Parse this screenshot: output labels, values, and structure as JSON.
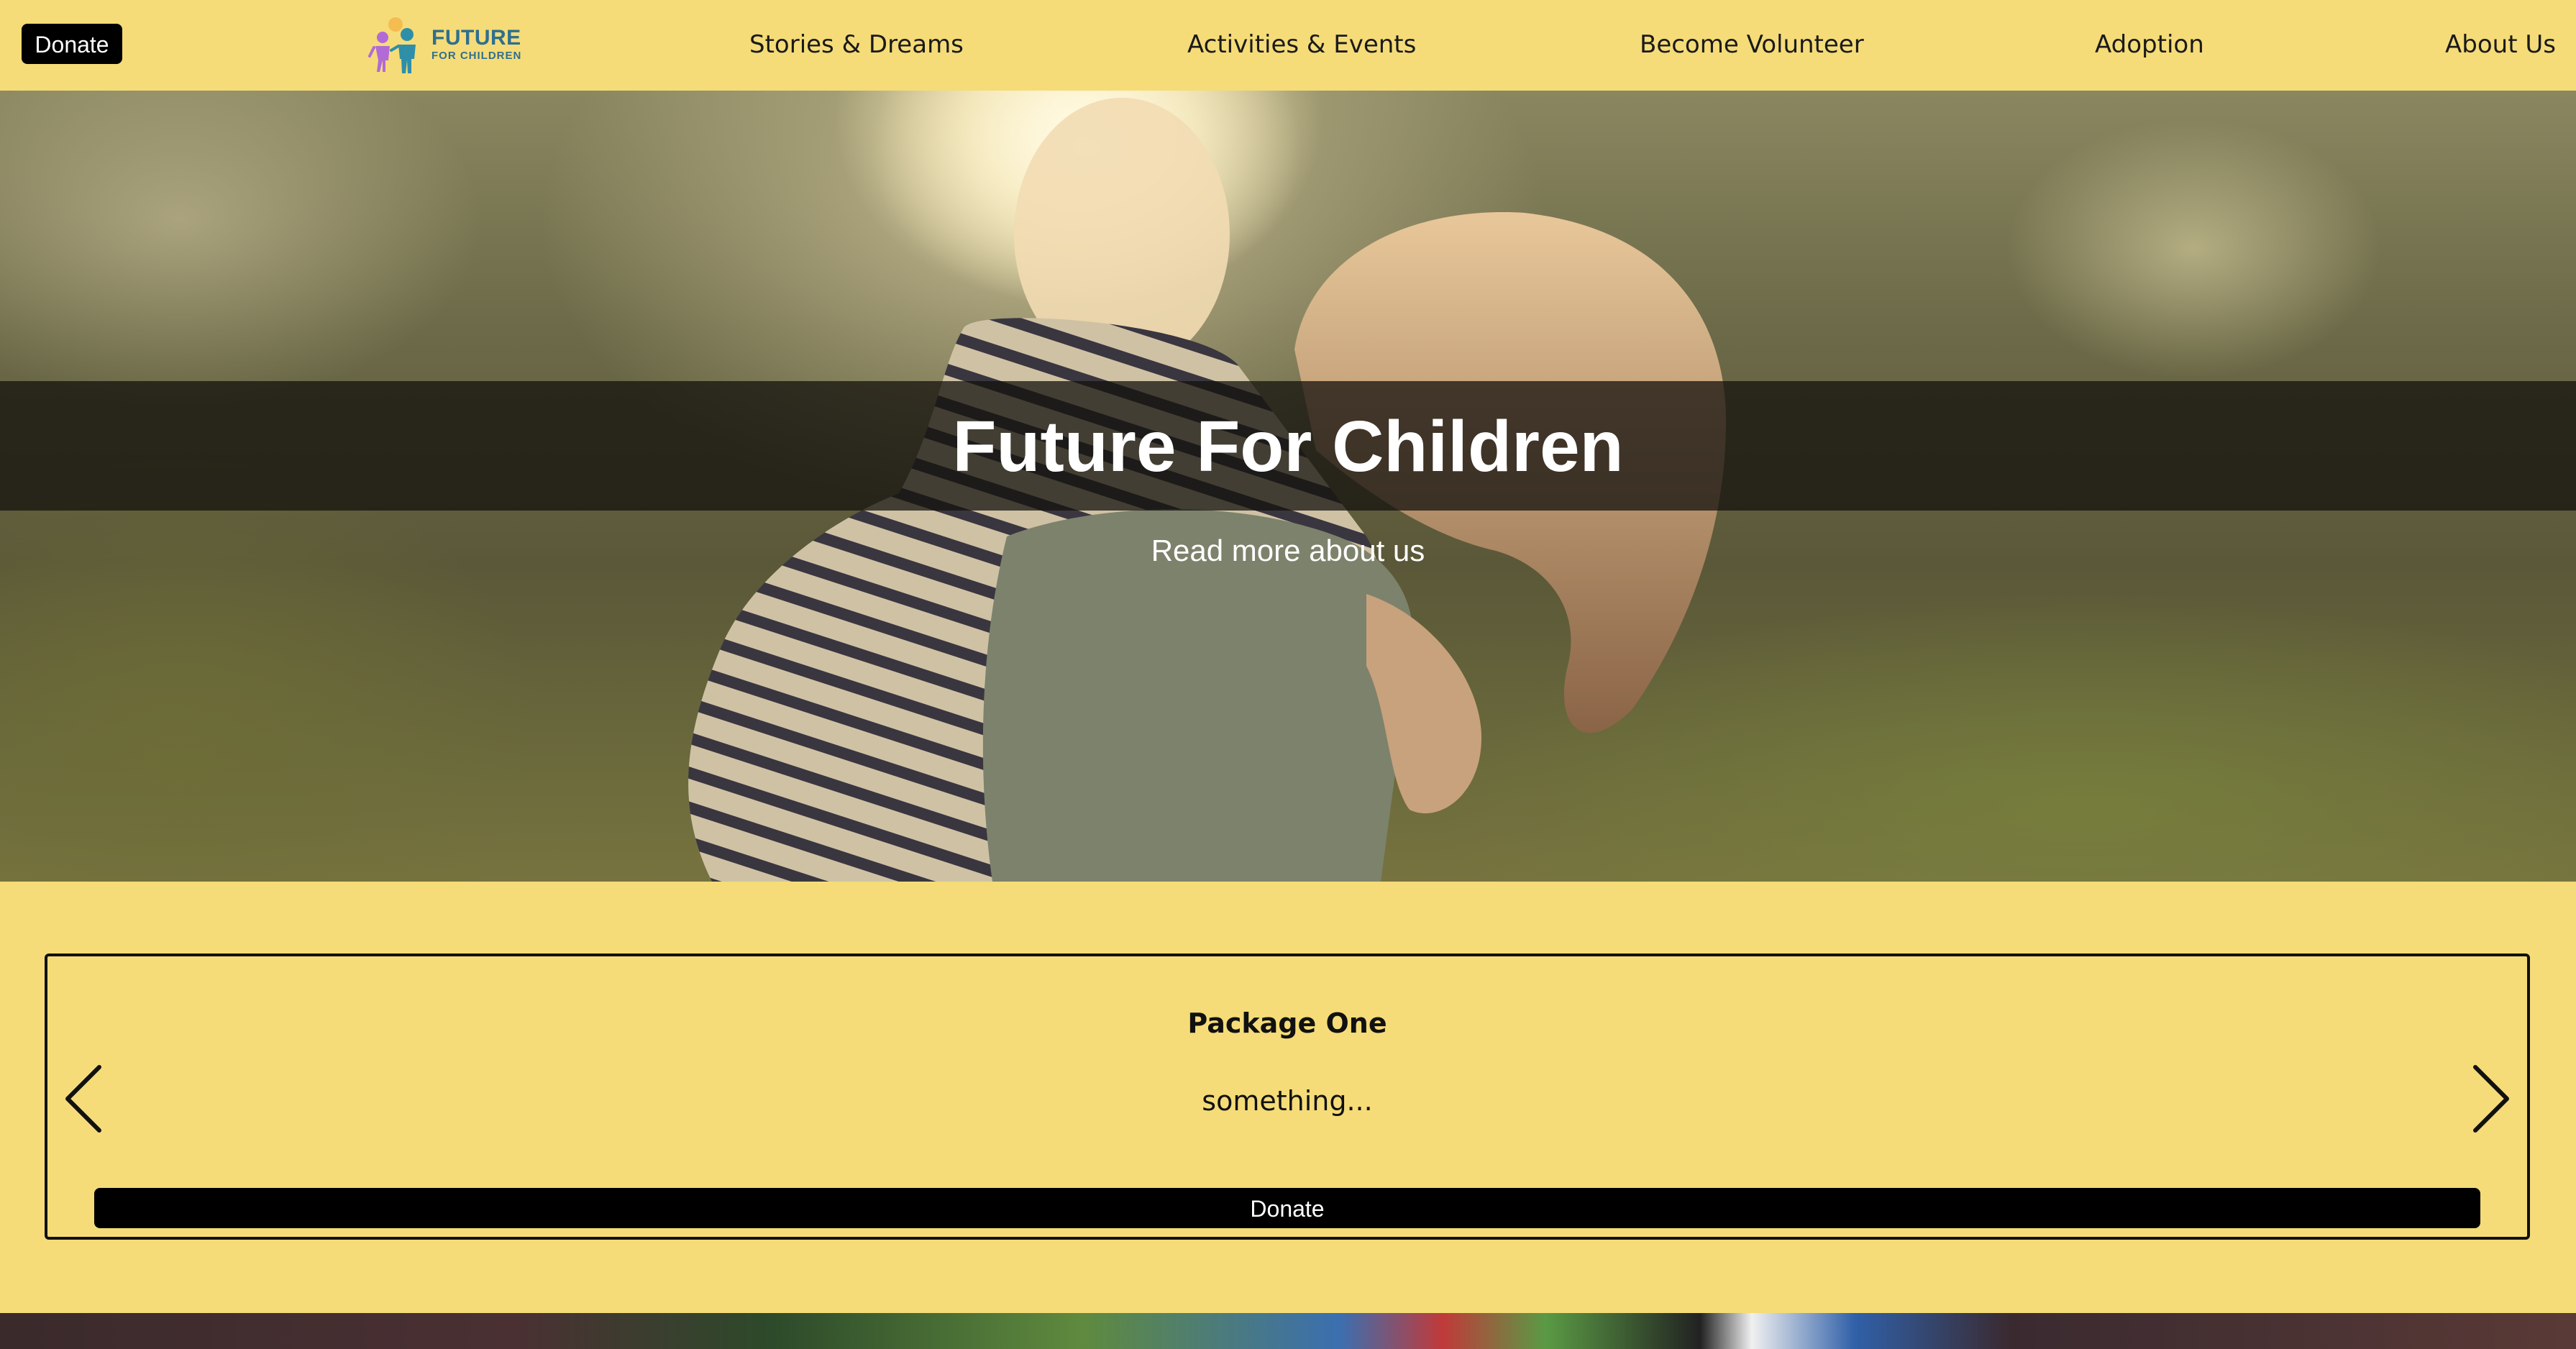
{
  "header": {
    "donate_label": "Donate",
    "logo": {
      "line1": "FUTURE",
      "line2": "FOR CHILDREN"
    },
    "nav": [
      {
        "label": "Stories & Dreams"
      },
      {
        "label": "Activities & Events"
      },
      {
        "label": "Become Volunteer"
      },
      {
        "label": "Adoption"
      },
      {
        "label": "About Us"
      }
    ]
  },
  "hero": {
    "title": "Future For Children",
    "link_label": "Read more about us"
  },
  "package": {
    "title": "Package One",
    "description": "something...",
    "donate_label": "Donate",
    "prev_icon": "chevron-left-icon",
    "next_icon": "chevron-right-icon"
  },
  "colors": {
    "background": "#f5dc78",
    "button": "#000000",
    "button_text": "#ffffff",
    "logo_text": "#2f6f8f"
  }
}
